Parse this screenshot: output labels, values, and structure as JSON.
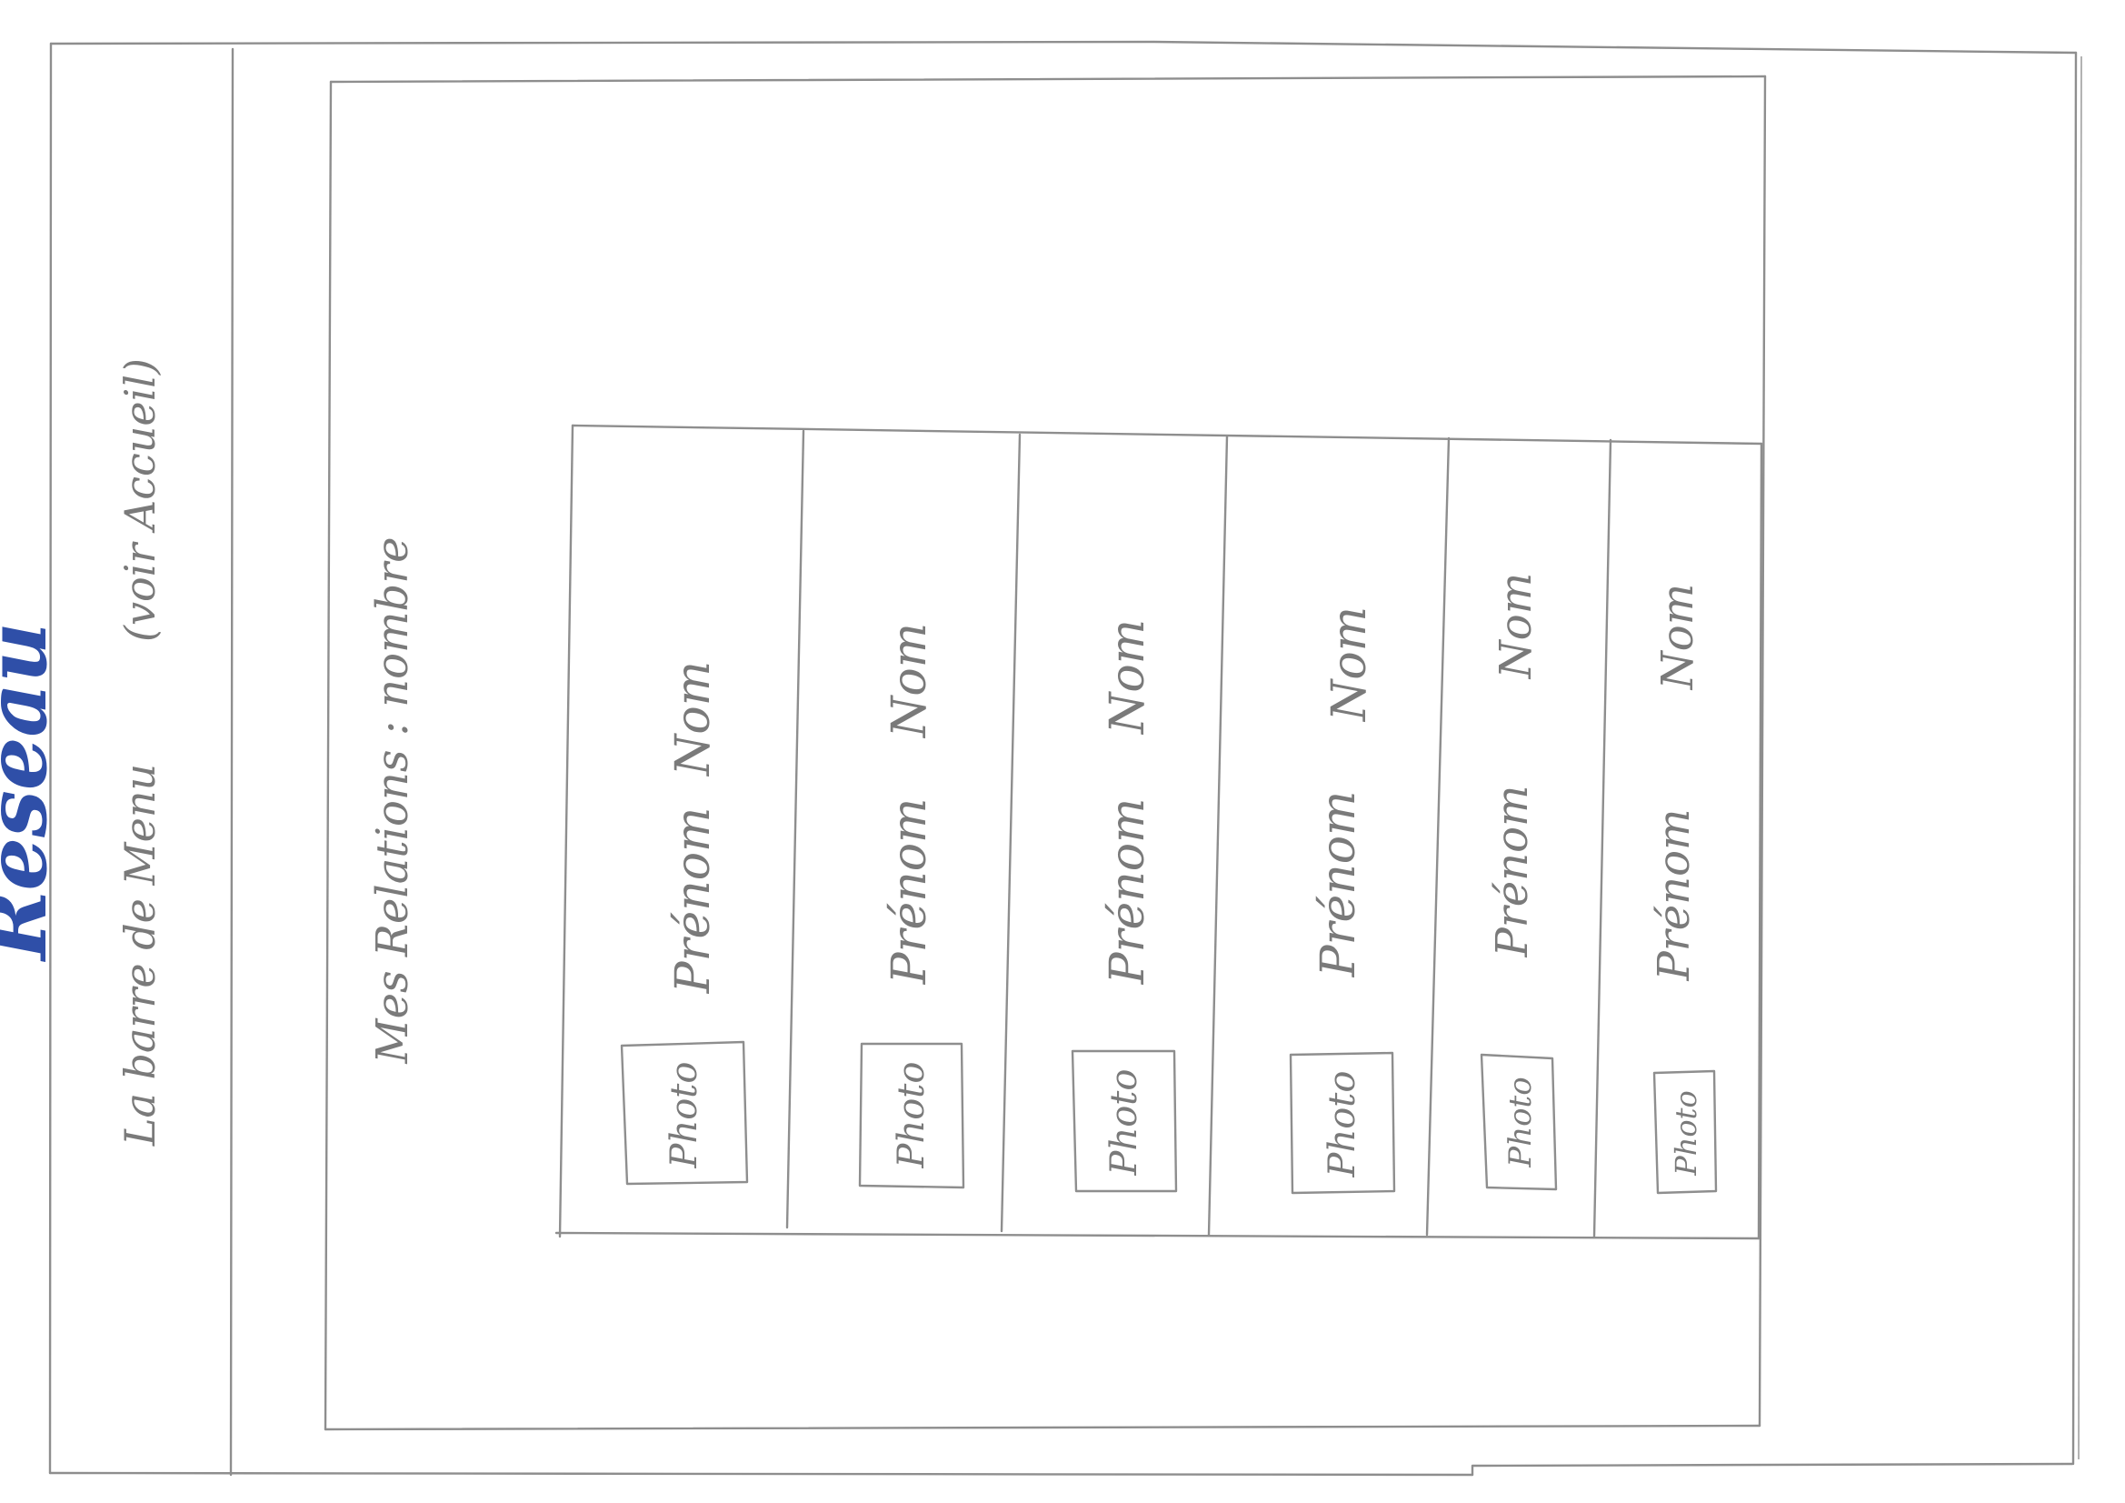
{
  "page": {
    "title": "Réseau"
  },
  "sidebar": {
    "menu_label": "La barre de Menu",
    "menu_note": "(voir Accueil)"
  },
  "main": {
    "relations_heading": "Mes Relations : nombre"
  },
  "relations": [
    {
      "photo_label": "Photo",
      "first_name": "Prénom",
      "last_name": "Nom"
    },
    {
      "photo_label": "Photo",
      "first_name": "Prénom",
      "last_name": "Nom"
    },
    {
      "photo_label": "Photo",
      "first_name": "Prénom",
      "last_name": "Nom"
    },
    {
      "photo_label": "Photo",
      "first_name": "Prénom",
      "last_name": "Nom"
    },
    {
      "photo_label": "Photo",
      "first_name": "Prénom",
      "last_name": "Nom"
    },
    {
      "photo_label": "Photo",
      "first_name": "Prénom",
      "last_name": "Nom"
    }
  ],
  "colors": {
    "pencil": "#8e8e8e",
    "title_ink": "#2f4fa8",
    "paper": "#ffffff"
  }
}
